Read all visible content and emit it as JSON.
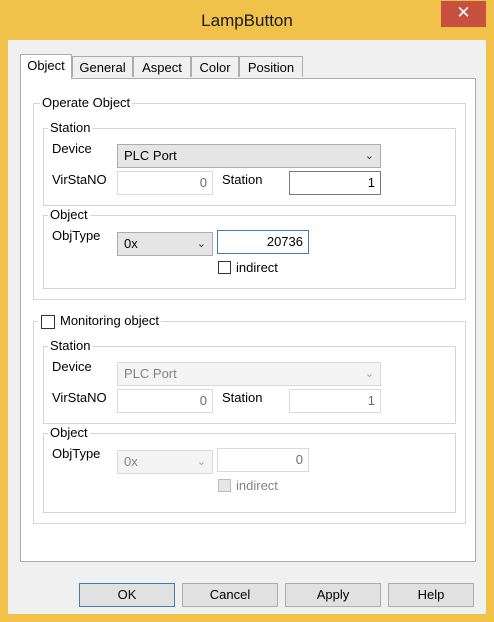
{
  "window": {
    "title": "LampButton",
    "close_glyph": "✕"
  },
  "tabs": [
    {
      "label": "Object"
    },
    {
      "label": "General"
    },
    {
      "label": "Aspect"
    },
    {
      "label": "Color"
    },
    {
      "label": "Position"
    }
  ],
  "operate": {
    "group_label": "Operate Object",
    "station": {
      "group_label": "Station",
      "device_label": "Device",
      "device_value": "PLC Port",
      "virstano_label": "VirStaNO",
      "virstano_value": "0",
      "station_label": "Station",
      "station_value": "1"
    },
    "object": {
      "group_label": "Object",
      "objtype_label": "ObjType",
      "objtype_value": "0x",
      "address_value": "20736",
      "indirect_label": "indirect"
    }
  },
  "monitoring": {
    "checkbox_label": "Monitoring object",
    "station": {
      "group_label": "Station",
      "device_label": "Device",
      "device_value": "PLC Port",
      "virstano_label": "VirStaNO",
      "virstano_value": "0",
      "station_label": "Station",
      "station_value": "1"
    },
    "object": {
      "group_label": "Object",
      "objtype_label": "ObjType",
      "objtype_value": "0x",
      "address_value": "0",
      "indirect_label": "indirect"
    }
  },
  "buttons": {
    "ok": "OK",
    "cancel": "Cancel",
    "apply": "Apply",
    "help": "Help"
  },
  "colors": {
    "title_accent": "#f0c24a",
    "close_red": "#c7503e",
    "focus_blue": "#3c7fb1"
  }
}
